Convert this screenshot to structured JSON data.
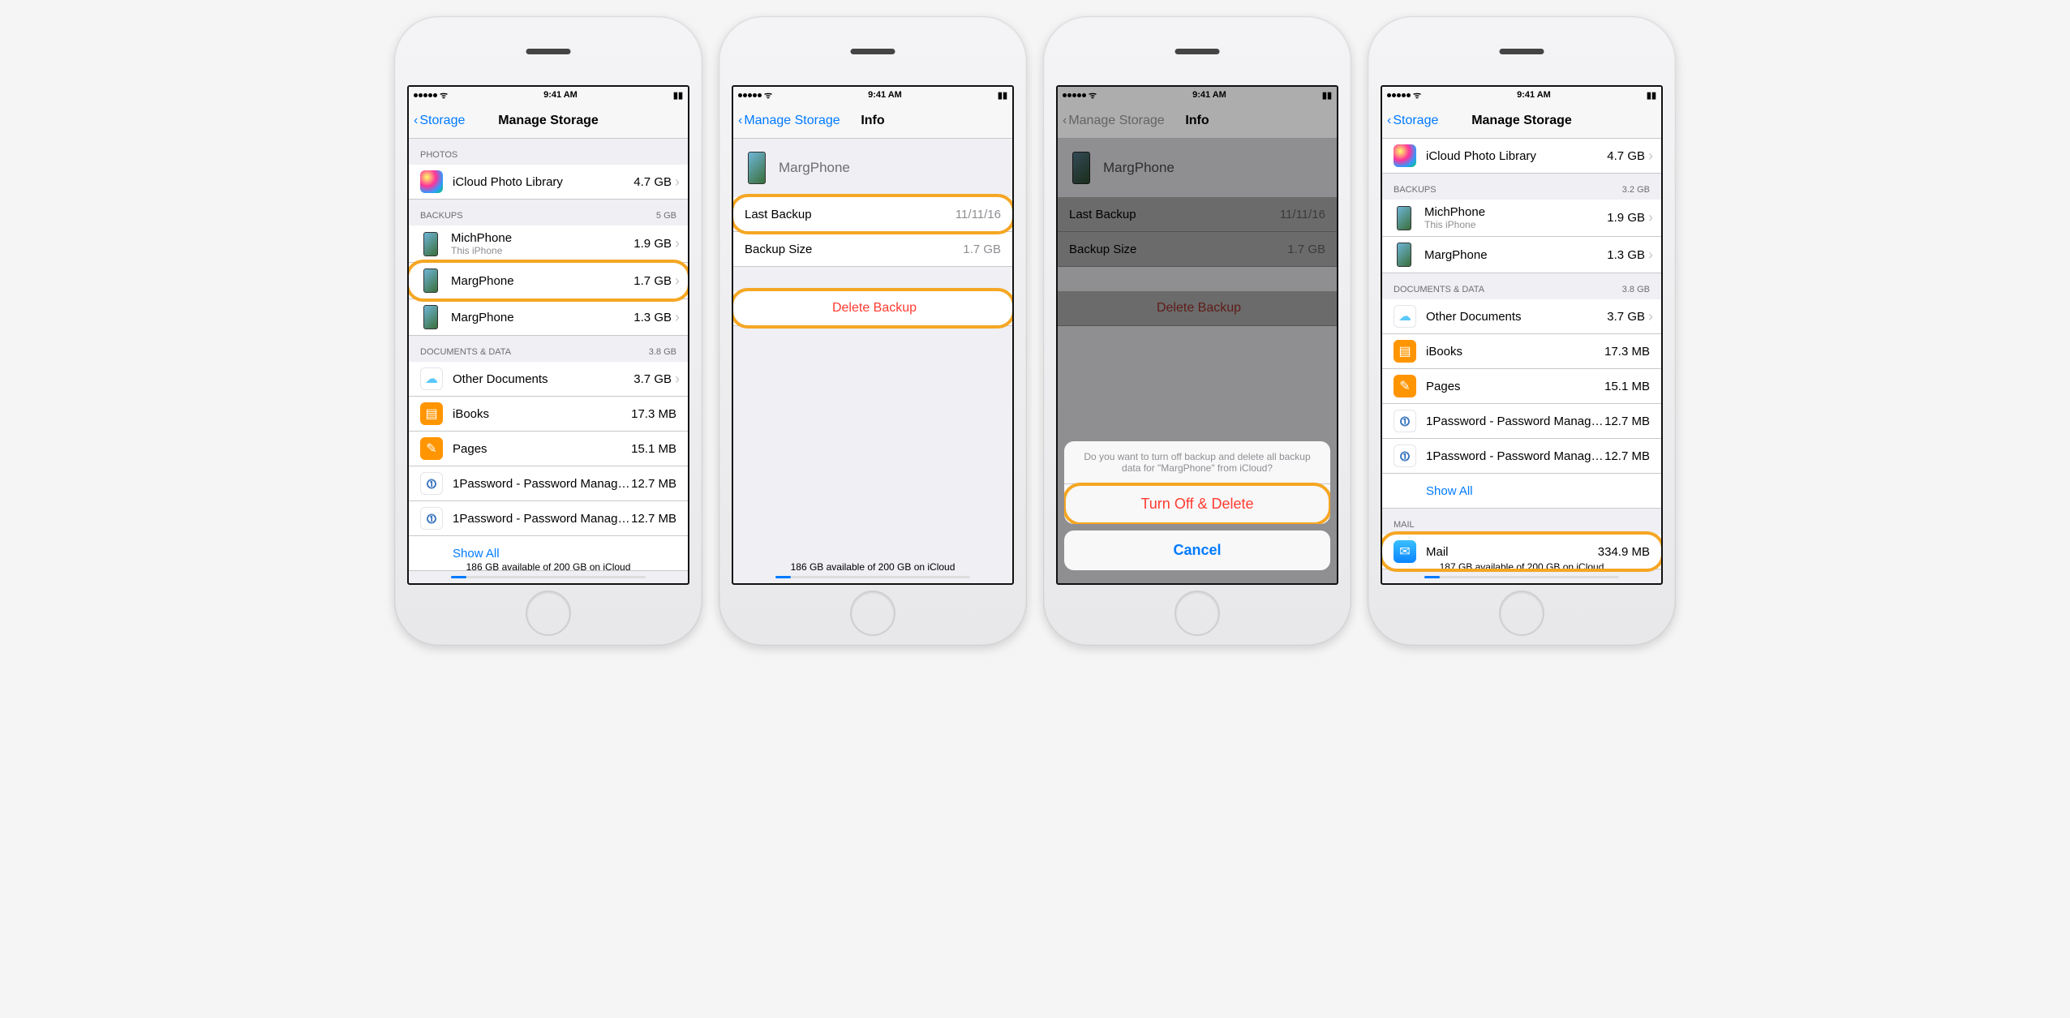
{
  "status": {
    "time": "9:41 AM"
  },
  "screens": [
    {
      "nav": {
        "back": "Storage",
        "title": "Manage Storage"
      },
      "footer": "186 GB available of 200 GB on iCloud",
      "sections": {
        "photos": {
          "header": "PHOTOS",
          "item": {
            "label": "iCloud Photo Library",
            "value": "4.7 GB"
          }
        },
        "backups": {
          "header": "BACKUPS",
          "headerValue": "5 GB",
          "items": [
            {
              "label": "MichPhone",
              "sub": "This iPhone",
              "value": "1.9 GB"
            },
            {
              "label": "MargPhone",
              "value": "1.7 GB",
              "highlighted": true
            },
            {
              "label": "MargPhone",
              "value": "1.3 GB"
            }
          ]
        },
        "docs": {
          "header": "DOCUMENTS & DATA",
          "headerValue": "3.8 GB",
          "items": [
            {
              "label": "Other Documents",
              "value": "3.7 GB"
            },
            {
              "label": "iBooks",
              "value": "17.3 MB"
            },
            {
              "label": "Pages",
              "value": "15.1 MB"
            },
            {
              "label": "1Password - Password Manager an...",
              "value": "12.7 MB"
            },
            {
              "label": "1Password - Password Manager an...",
              "value": "12.7 MB"
            }
          ],
          "showAll": "Show All"
        }
      }
    },
    {
      "nav": {
        "back": "Manage Storage",
        "title": "Info"
      },
      "footer": "186 GB available of 200 GB on iCloud",
      "device": "MargPhone",
      "rows": [
        {
          "label": "Last Backup",
          "value": "11/11/16",
          "highlighted": true
        },
        {
          "label": "Backup Size",
          "value": "1.7 GB"
        }
      ],
      "delete": "Delete Backup"
    },
    {
      "nav": {
        "back": "Manage Storage",
        "title": "Info"
      },
      "device": "MargPhone",
      "rows": [
        {
          "label": "Last Backup",
          "value": "11/11/16"
        },
        {
          "label": "Backup Size",
          "value": "1.7 GB"
        }
      ],
      "delete": "Delete Backup",
      "sheet": {
        "message": "Do you want to turn off backup and delete all backup data for \"MargPhone\" from iCloud?",
        "destructive": "Turn Off & Delete",
        "cancel": "Cancel"
      }
    },
    {
      "nav": {
        "back": "Storage",
        "title": "Manage Storage"
      },
      "footer": "187 GB available of 200 GB on iCloud",
      "photos": {
        "label": "iCloud Photo Library",
        "value": "4.7 GB"
      },
      "backups": {
        "header": "BACKUPS",
        "headerValue": "3.2 GB",
        "items": [
          {
            "label": "MichPhone",
            "sub": "This iPhone",
            "value": "1.9 GB"
          },
          {
            "label": "MargPhone",
            "value": "1.3 GB"
          }
        ]
      },
      "docs": {
        "header": "DOCUMENTS & DATA",
        "headerValue": "3.8 GB",
        "items": [
          {
            "label": "Other Documents",
            "value": "3.7 GB"
          },
          {
            "label": "iBooks",
            "value": "17.3 MB"
          },
          {
            "label": "Pages",
            "value": "15.1 MB"
          },
          {
            "label": "1Password - Password Manager an...",
            "value": "12.7 MB"
          },
          {
            "label": "1Password - Password Manager an...",
            "value": "12.7 MB"
          }
        ],
        "showAll": "Show All"
      },
      "mail": {
        "header": "MAIL",
        "label": "Mail",
        "value": "334.9 MB",
        "highlighted": true
      }
    }
  ]
}
